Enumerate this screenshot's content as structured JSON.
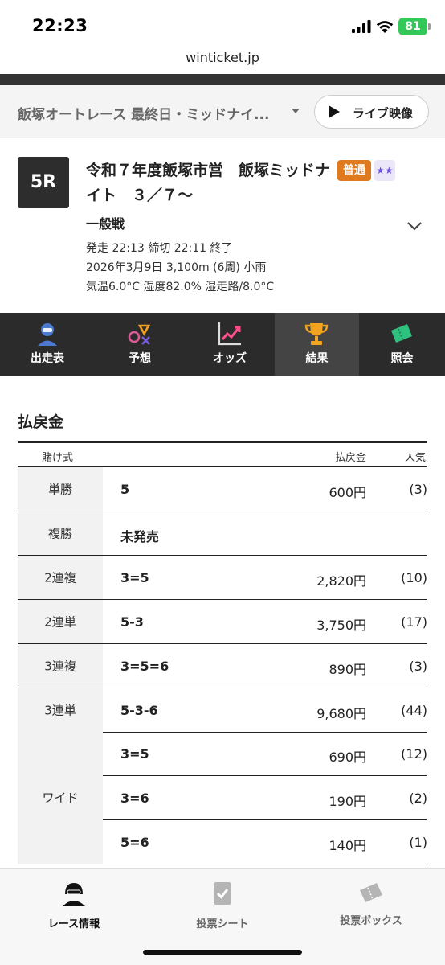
{
  "status_bar": {
    "time": "22:23",
    "battery": "81"
  },
  "browser": {
    "url": "winticket.jp"
  },
  "header": {
    "venue_title": "飯塚オートレース 最終日・ミッドナイ...",
    "live_button": "ライブ映像"
  },
  "race": {
    "number": "5R",
    "title": "令和７年度飯塚市営　飯塚ミッドナイト　３／７〜",
    "badge": "普通",
    "grade": "一般戦",
    "meta1": "発走 22:13 締切 22:11  終了",
    "meta2": "2026年3月9日 3,100m (6周) 小雨",
    "meta3": "気温6.0°C 湿度82.0% 湿走路/8.0°C"
  },
  "tabs": [
    {
      "label": "出走表",
      "icon": "racer-icon"
    },
    {
      "label": "予想",
      "icon": "prediction-icon"
    },
    {
      "label": "オッズ",
      "icon": "odds-chart-icon"
    },
    {
      "label": "結果",
      "icon": "trophy-icon",
      "active": true
    },
    {
      "label": "照会",
      "icon": "ticket-icon"
    }
  ],
  "payout": {
    "title": "払戻金",
    "headers": {
      "type": "賭け式",
      "amount": "払戻金",
      "popularity": "人気"
    },
    "rows": [
      {
        "type": "単勝",
        "combo": "5",
        "amount": "600円",
        "popularity": "(3)"
      },
      {
        "type": "複勝",
        "combo": "未発売",
        "amount": "",
        "popularity": ""
      },
      {
        "type": "2連複",
        "combo": "3=5",
        "amount": "2,820円",
        "popularity": "(10)"
      },
      {
        "type": "2連単",
        "combo": "5-3",
        "amount": "3,750円",
        "popularity": "(17)"
      },
      {
        "type": "3連複",
        "combo": "3=5=6",
        "amount": "890円",
        "popularity": "(3)"
      },
      {
        "type": "3連単",
        "combo": "5-3-6",
        "amount": "9,680円",
        "popularity": "(44)"
      }
    ],
    "wide": {
      "type": "ワイド",
      "rows": [
        {
          "combo": "3=5",
          "amount": "690円",
          "popularity": "(12)"
        },
        {
          "combo": "3=6",
          "amount": "190円",
          "popularity": "(2)"
        },
        {
          "combo": "5=6",
          "amount": "140円",
          "popularity": "(1)"
        }
      ]
    }
  },
  "bottom_nav": [
    {
      "label": "レース情報",
      "active": true
    },
    {
      "label": "投票シート"
    },
    {
      "label": "投票ボックス"
    }
  ],
  "colors": {
    "accent_orange": "#e07a1f",
    "dark": "#2b2b2b",
    "battery_green": "#34c759"
  }
}
